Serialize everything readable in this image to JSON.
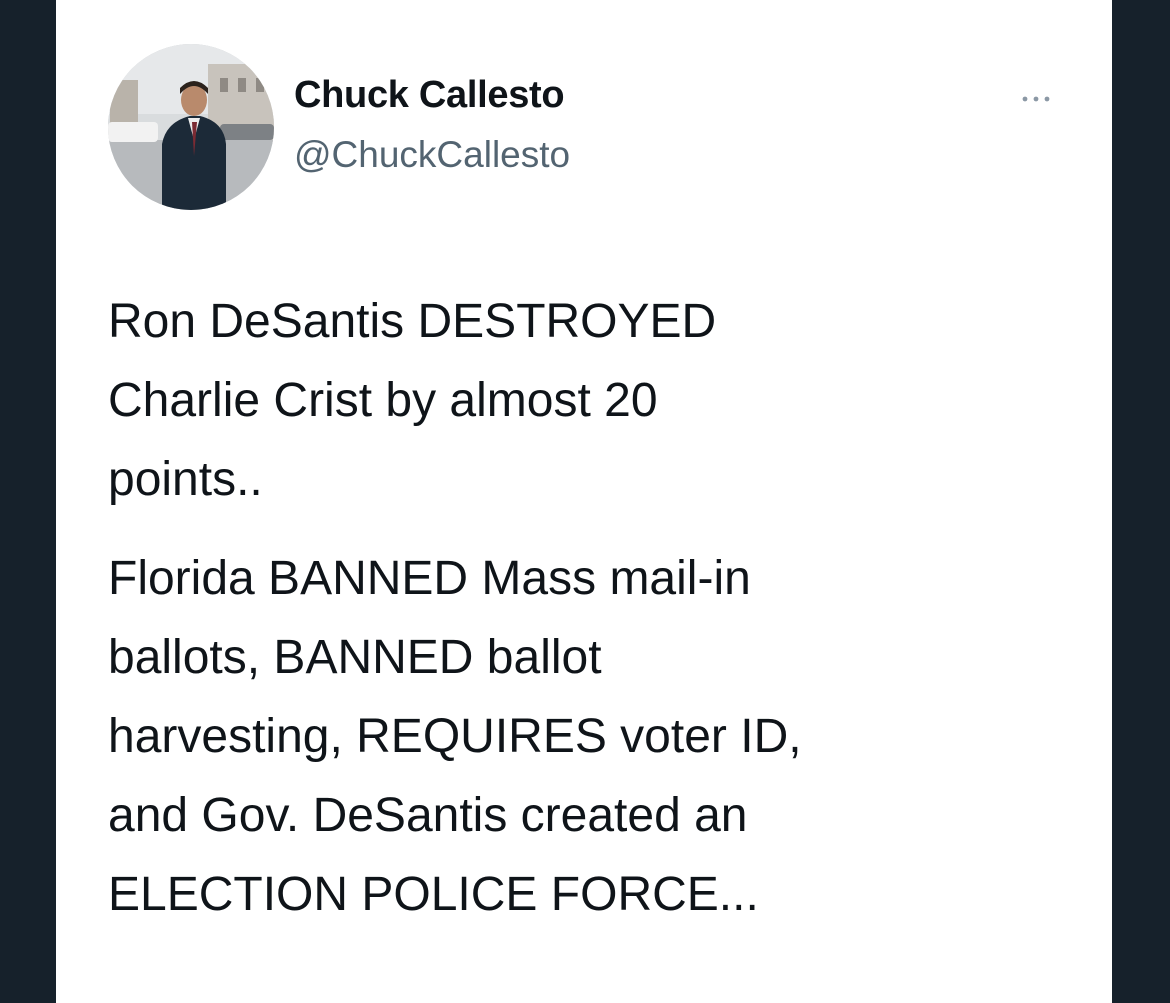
{
  "tweet": {
    "author": {
      "display_name": "Chuck Callesto",
      "handle": "@ChuckCallesto",
      "avatar_icon": "profile-photo"
    },
    "more_icon": "ellipsis-icon",
    "paragraphs": [
      "Ron DeSantis DESTROYED\nCharlie Crist by almost 20\npoints..",
      "Florida BANNED Mass mail-in\nballots, BANNED ballot\nharvesting, REQUIRES voter ID,\nand Gov. DeSantis created an\nELECTION POLICE FORCE..."
    ]
  },
  "colors": {
    "background": "#16212b",
    "card": "#ffffff",
    "text_primary": "#0f1419",
    "text_secondary": "#536471"
  }
}
